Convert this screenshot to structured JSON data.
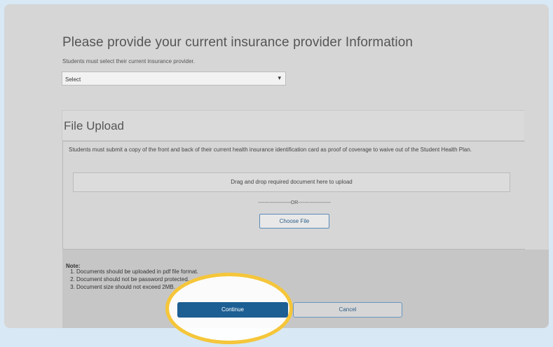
{
  "section": {
    "title": "Please provide your current insurance provider Information",
    "subtitle": "Students must select their current insurance provider.",
    "select_value": "Select"
  },
  "upload": {
    "title": "File Upload",
    "description": "Students must submit a copy of the front and back of their current health insurance identification card as proof of coverage to waive out of the Student Health Plan.",
    "dropzone_text": "Drag and drop required document here to upload",
    "or_text": "--------------------OR--------------------",
    "choose_file_label": "Choose File"
  },
  "note": {
    "label": "Note:",
    "items": [
      "Documents should be uploaded in pdf file format.",
      "Document should not be password protected.",
      "Document size should not exceed 2MB."
    ]
  },
  "actions": {
    "continue_label": "Continue",
    "cancel_label": "Cancel"
  },
  "colors": {
    "background": "#d8e8f4",
    "primary": "#1d5e93",
    "highlight": "#f5c63a"
  }
}
